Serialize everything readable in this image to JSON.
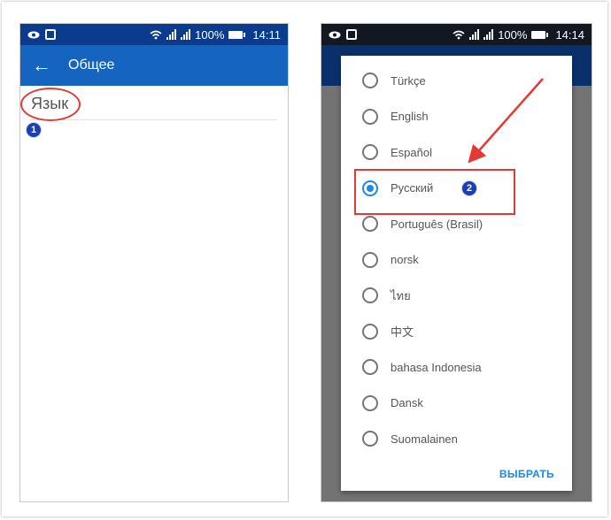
{
  "colors": {
    "status_bar_left": "#0b3b8f",
    "status_bar_right": "#111822",
    "app_bar": "#1565c0",
    "accent": "#1e88e5",
    "annotation_red": "#e53935",
    "badge_blue": "#1a3fb0"
  },
  "status_bar": {
    "battery": "100%",
    "time_left": "14:11",
    "time_right": "14:14",
    "icons": [
      "eye-icon",
      "cast-icon",
      "wifi-icon",
      "signal-icon",
      "signal-icon",
      "battery-icon"
    ]
  },
  "screen1": {
    "back_icon": "←",
    "title": "Общее",
    "setting_label": "Язык",
    "step_badge": "1"
  },
  "screen2": {
    "dialog": {
      "options": [
        {
          "label": "Türkçe",
          "selected": false
        },
        {
          "label": "English",
          "selected": false
        },
        {
          "label": "Español",
          "selected": false
        },
        {
          "label": "Русский",
          "selected": true
        },
        {
          "label": "Português (Brasil)",
          "selected": false
        },
        {
          "label": "norsk",
          "selected": false
        },
        {
          "label": "ไทย",
          "selected": false
        },
        {
          "label": "中文",
          "selected": false
        },
        {
          "label": "bahasa Indonesia",
          "selected": false
        },
        {
          "label": "Dansk",
          "selected": false
        },
        {
          "label": "Suomalainen",
          "selected": false
        }
      ],
      "select_button": "ВЫБРАТЬ"
    },
    "step_badge": "2"
  }
}
